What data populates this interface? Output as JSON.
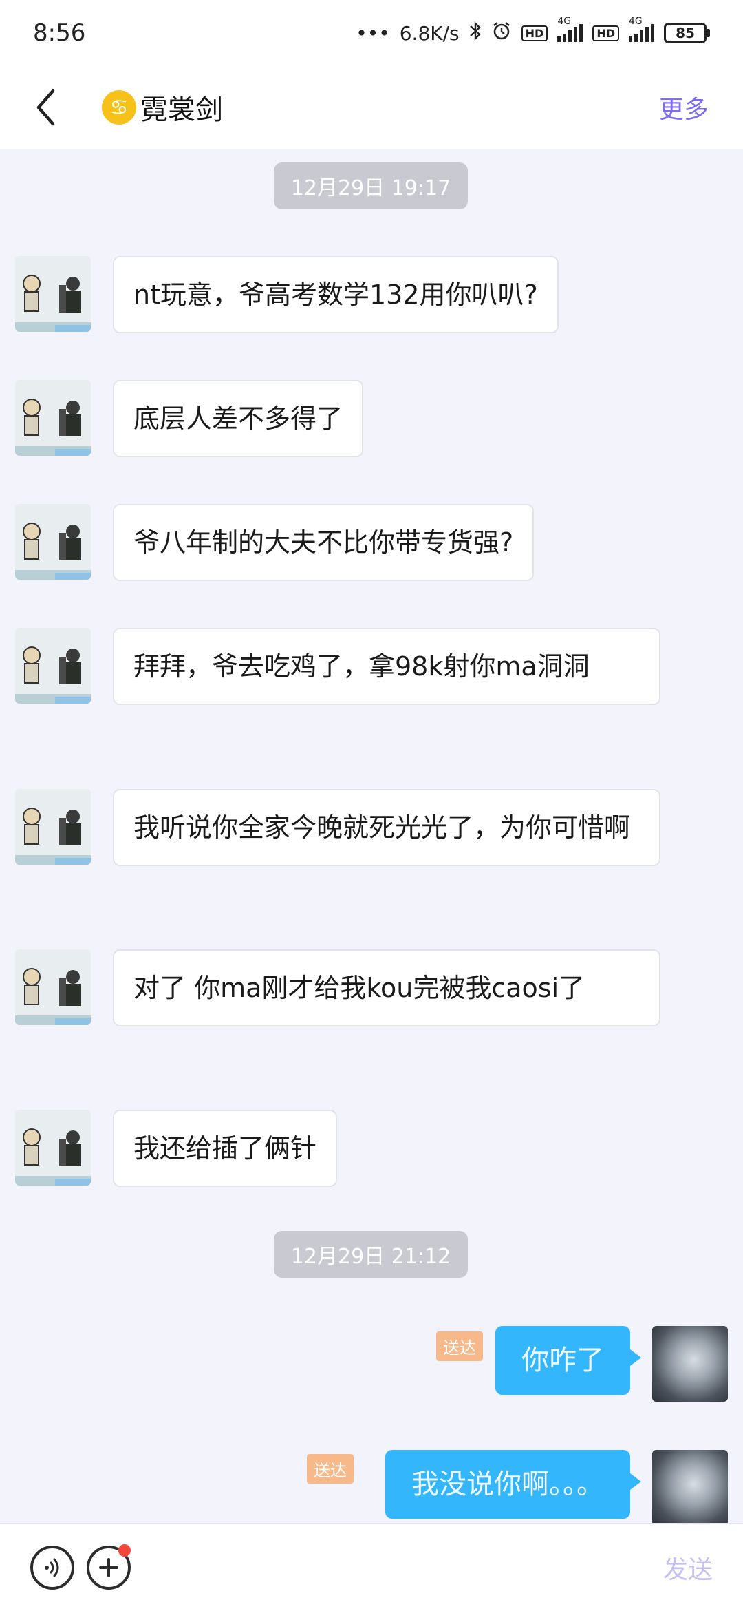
{
  "status_bar": {
    "time": "8:56",
    "net_speed": "6.8K/s",
    "network_label_1": "4G",
    "network_label_2": "4G",
    "hd_label": "HD",
    "battery": "85"
  },
  "nav": {
    "emoji": "♋",
    "title": "霓裳剑",
    "more": "更多"
  },
  "timestamps": [
    "12月29日 19:17",
    "12月29日 21:12"
  ],
  "incoming": [
    {
      "text": "nt玩意，爷高考数学132用你叭叭?"
    },
    {
      "text": "底层人差不多得了"
    },
    {
      "text": "爷八年制的大夫不比你带专货强?"
    },
    {
      "text": "拜拜，爷去吃鸡了，拿98k射你ma洞洞"
    },
    {
      "text": "我听说你全家今晚就死光光了，为你可惜啊"
    },
    {
      "text": "对了 你ma刚才给我kou完被我caosi了"
    },
    {
      "text": "我还给插了俩针"
    }
  ],
  "outgoing": [
    {
      "text": "你咋了",
      "status": "送达"
    },
    {
      "text": "我没说你啊。。。",
      "status": "送达"
    }
  ],
  "input_bar": {
    "send": "发送"
  },
  "colors": {
    "accent": "#7b6cf0",
    "bubble_out": "#33b6fb",
    "delivered": "#f8b98a",
    "badge": "#f5463b"
  }
}
